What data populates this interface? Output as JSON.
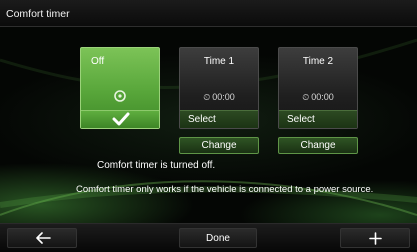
{
  "window": {
    "title": "Comfort timer"
  },
  "tiles": [
    {
      "label": "Off",
      "selected": true
    },
    {
      "label": "Time 1",
      "time": "00:00",
      "select_label": "Select"
    },
    {
      "label": "Time 2",
      "time": "00:00",
      "select_label": "Select"
    }
  ],
  "change_buttons": [
    "Change",
    "Change"
  ],
  "status": "Comfort timer is turned off.",
  "info": "Comfort timer only works if the vehicle is connected to a power source.",
  "bottom_bar": {
    "done_label": "Done",
    "back_icon": "back-arrow-icon",
    "plus_icon": "plus-icon"
  },
  "colors": {
    "accent": "#5fae3f",
    "background": "#040604"
  }
}
